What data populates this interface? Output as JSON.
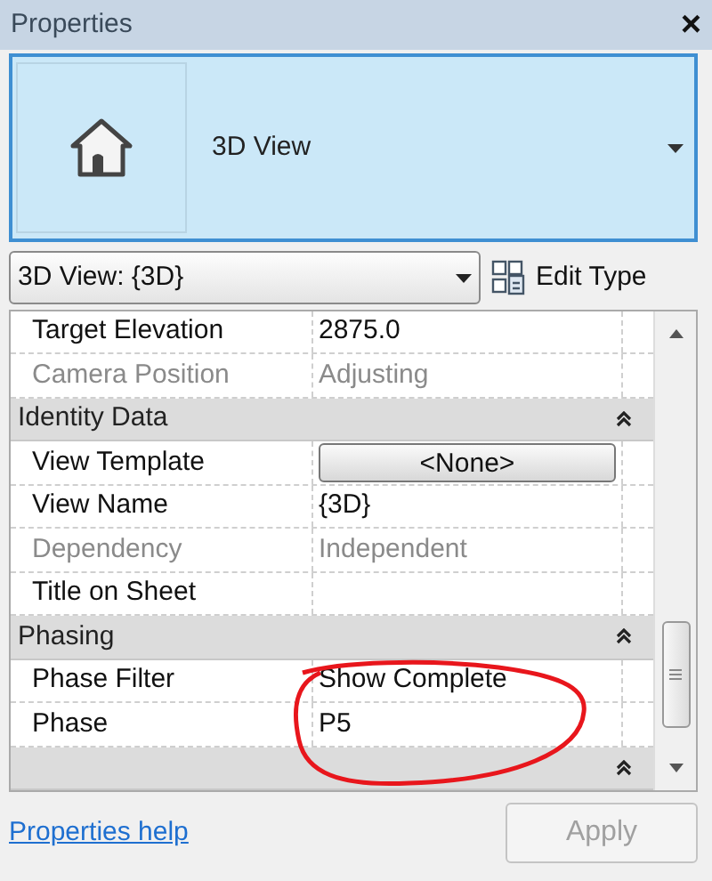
{
  "window": {
    "title": "Properties",
    "close": "×"
  },
  "type_selector": {
    "name": "3D View"
  },
  "instance_dropdown": {
    "value": "3D View: {3D}"
  },
  "edit_type": {
    "label": "Edit Type"
  },
  "rows": [
    {
      "kind": "property",
      "label": "Target Elevation",
      "value": "2875.0",
      "disabled": false
    },
    {
      "kind": "property",
      "label": "Camera Position",
      "value": "Adjusting",
      "disabled": true
    },
    {
      "kind": "section",
      "label": "Identity Data",
      "expanded": true
    },
    {
      "kind": "button",
      "label": "View Template",
      "value": "<None>",
      "disabled": false
    },
    {
      "kind": "property",
      "label": "View Name",
      "value": "{3D}",
      "disabled": false
    },
    {
      "kind": "property",
      "label": "Dependency",
      "value": "Independent",
      "disabled": true
    },
    {
      "kind": "property",
      "label": "Title on Sheet",
      "value": "",
      "disabled": false
    },
    {
      "kind": "section",
      "label": "Phasing",
      "expanded": true
    },
    {
      "kind": "property",
      "label": "Phase Filter",
      "value": "Show Complete",
      "disabled": false
    },
    {
      "kind": "property",
      "label": "Phase",
      "value": "P5",
      "disabled": false
    },
    {
      "kind": "section",
      "expanded": true
    }
  ],
  "footer": {
    "help_link": "Properties help",
    "apply": {
      "label": "Apply",
      "disabled": true
    }
  }
}
